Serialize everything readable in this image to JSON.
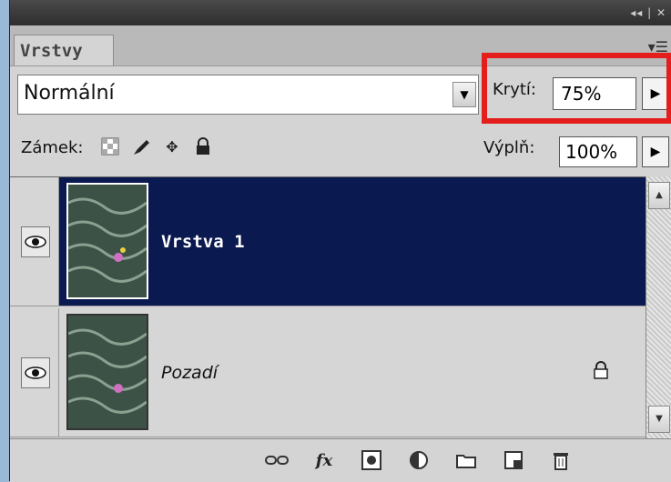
{
  "panel": {
    "window_controls": "◂◂ | ✕",
    "tab_label": "Vrstvy",
    "menu_icon": "panel-menu-icon"
  },
  "blend_mode": {
    "value": "Normální"
  },
  "opacity": {
    "label": "Krytí:",
    "value": "75%"
  },
  "lock": {
    "label": "Zámek:",
    "icons": [
      "lock-transparent-icon",
      "lock-paint-icon",
      "lock-move-icon",
      "lock-all-icon"
    ]
  },
  "fill": {
    "label": "Výplň:",
    "value": "100%"
  },
  "layers": [
    {
      "name": "Vrstva 1",
      "selected": true,
      "visible": true,
      "locked": false
    },
    {
      "name": "Pozadí",
      "selected": false,
      "visible": true,
      "locked": true
    }
  ],
  "bottom_icons": [
    "link-icon",
    "fx-icon",
    "mask-icon",
    "adjustment-icon",
    "folder-icon",
    "new-layer-icon",
    "trash-icon"
  ],
  "colors": {
    "selection": "#0a1a50",
    "highlight": "#e41d1d"
  }
}
